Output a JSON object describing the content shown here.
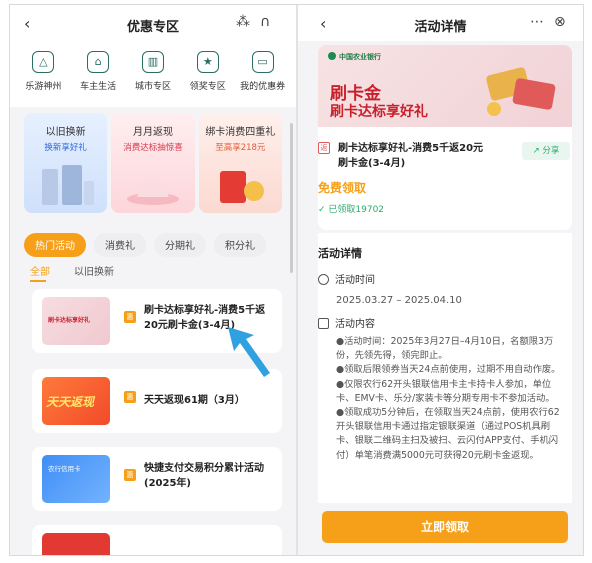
{
  "left_panel": {
    "title": "优惠专区",
    "quick_links": [
      "乐游神州",
      "车主生活",
      "城市专区",
      "领奖专区",
      "我的优惠券"
    ],
    "promos": [
      {
        "title": "以旧换新",
        "subtitle": "换新享好礼"
      },
      {
        "title": "月月返现",
        "subtitle": "消费达标抽惊喜"
      },
      {
        "title": "绑卡消费四重礼",
        "subtitle": "至高享218元"
      }
    ],
    "tabs": [
      "热门活动",
      "消费礼",
      "分期礼",
      "积分礼"
    ],
    "subtabs": [
      "全部",
      "以旧换新"
    ],
    "activities": [
      {
        "title": "刷卡达标享好礼-消费5千返20元刷卡金(3-4月)",
        "thumb_title": "刷卡达标享好礼",
        "badge": "惠"
      },
      {
        "title": "天天返现61期（3月）",
        "thumb_title": "天天返现",
        "badge": "惠"
      },
      {
        "title": "快捷支付交易积分累计活动(2025年)",
        "thumb_title": "农行信用卡",
        "badge": "惠"
      },
      {
        "title": "",
        "thumb_title": "",
        "badge": ""
      }
    ]
  },
  "right_panel": {
    "title": "活动详情",
    "bank_name": "中国农业银行",
    "banner_line1": "刷卡金",
    "banner_line2": "刷卡达标享好礼",
    "tag": "返",
    "activity_title": "刷卡达标享好礼-消费5千返20元刷卡金(3-4月)",
    "share_label": "分享",
    "free_label": "免费领取",
    "claimed_label": "已领取19702",
    "section_title": "活动详情",
    "time_label": "活动时间",
    "time_value": "2025.03.27 – 2025.04.10",
    "content_label": "活动内容",
    "rules": [
      "●活动时间：2025年3月27日–4月10日，名额限3万份，先领先得，领完即止。",
      "●领取后限领券当天24点前使用，过期不用自动作废。",
      "●仅限农行62开头银联信用卡主卡持卡人参加，单位卡、EMV卡、乐分/家装卡等分期专用卡不参加活动。",
      "●领取成功5分钟后，在领取当天24点前，使用农行62开头银联信用卡通过指定银联渠道（通过POS机具刷卡、银联二维码主扫及被扫、云闪付APP支付、手机闪付）单笔消费满5000元可获得20元刷卡金返现。"
    ],
    "cta_label": "立即领取"
  },
  "colors": {
    "accent": "#f6a01a",
    "green": "#2eaa6e",
    "brand_red": "#c8202c",
    "arrow": "#2fa0e0"
  }
}
